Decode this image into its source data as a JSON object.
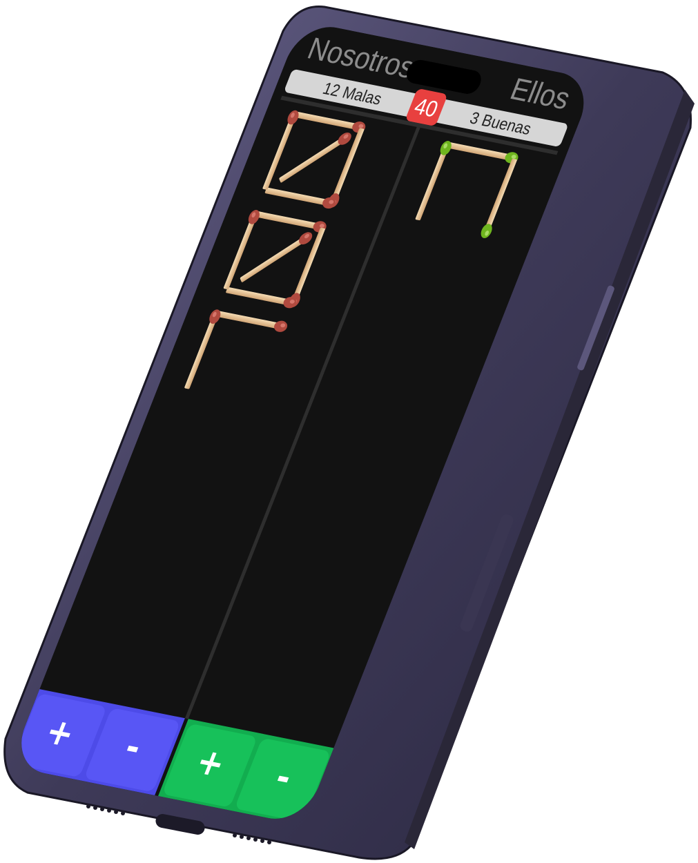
{
  "header": {
    "team_left": "Nosotros",
    "team_right": "Ellos",
    "left_status": "12 Malas",
    "right_status": "3 Buenas",
    "target_score": "40"
  },
  "scores": {
    "nosotros": {
      "points": 12,
      "phase": "Malas"
    },
    "ellos": {
      "points": 3,
      "phase": "Buenas"
    }
  },
  "controls": {
    "nosotros_plus": "+",
    "nosotros_minus": "-",
    "ellos_plus": "+",
    "ellos_minus": "-"
  },
  "colors": {
    "screen_bg": "#121212",
    "team_left_button": "#5856f5",
    "team_right_button": "#17c15a",
    "score_badge": "#e8403f",
    "match_head_malas": "#b34a3e",
    "match_head_buenas": "#7cc428",
    "match_stick": "#e9c898",
    "phone_frame": "#4b4766"
  },
  "icons": {
    "match": "matchstick-icon"
  }
}
